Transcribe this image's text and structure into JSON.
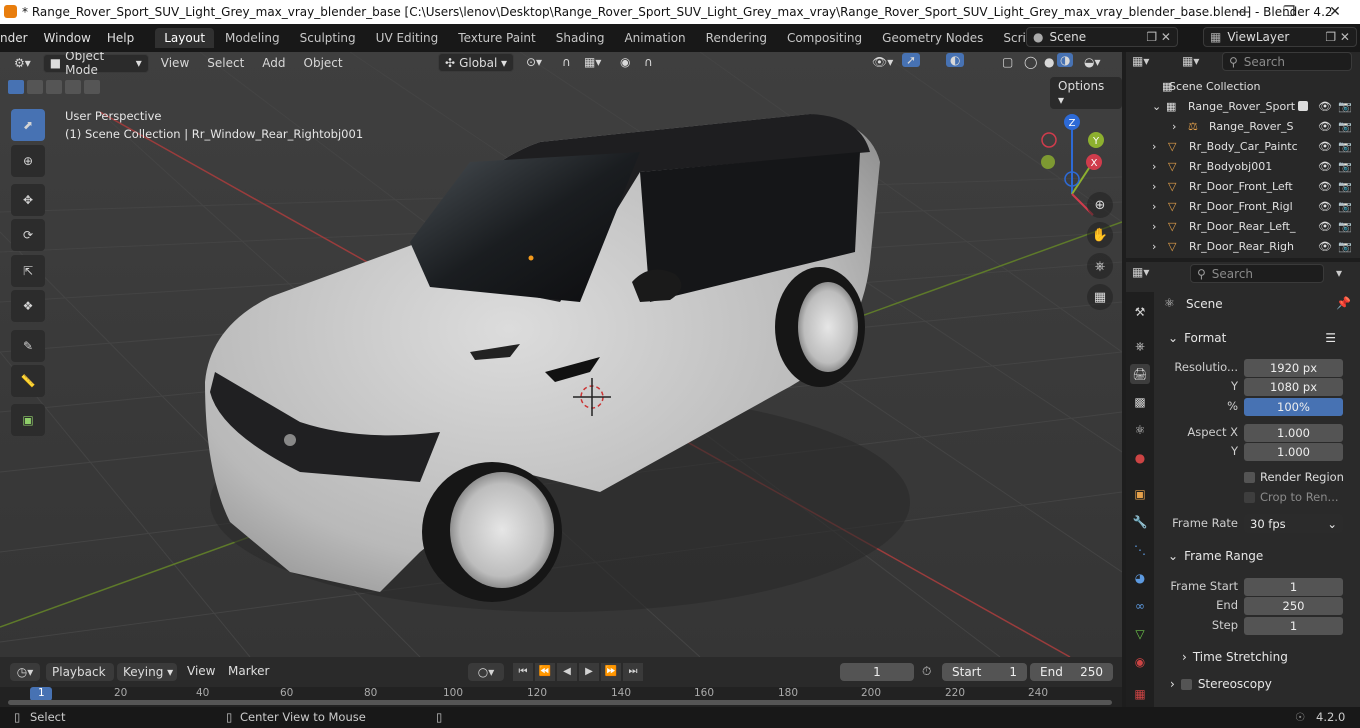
{
  "window": {
    "title": "* Range_Rover_Sport_SUV_Light_Grey_max_vray_blender_base [C:\\Users\\lenov\\Desktop\\Range_Rover_Sport_SUV_Light_Grey_max_vray\\Range_Rover_Sport_SUV_Light_Grey_max_vray_blender_base.blend] - Blender 4.2"
  },
  "menubar": {
    "items": [
      "nder",
      "Window",
      "Help"
    ],
    "workspaces": [
      "Layout",
      "Modeling",
      "Sculpting",
      "UV Editing",
      "Texture Paint",
      "Shading",
      "Animation",
      "Rendering",
      "Compositing",
      "Geometry Nodes",
      "Scripting"
    ],
    "active_workspace": "Layout",
    "add_tab": "+",
    "scene_label": "Scene",
    "viewlayer_label": "ViewLayer"
  },
  "viewport": {
    "mode": "Object Mode",
    "menus": [
      "View",
      "Select",
      "Add",
      "Object"
    ],
    "orientation": "Global",
    "options": "Options",
    "overlay_line1": "User Perspective",
    "overlay_line2": "(1) Scene Collection | Rr_Window_Rear_Rightobj001",
    "gizmo_axes": [
      "X",
      "Y",
      "Z"
    ]
  },
  "outliner": {
    "search_placeholder": "Search",
    "root": "Scene Collection",
    "items": [
      {
        "name": "Range_Rover_Sport",
        "depth": 1
      },
      {
        "name": "Range_Rover_S",
        "depth": 2
      },
      {
        "name": "Rr_Body_Car_Paintc",
        "depth": 1
      },
      {
        "name": "Rr_Bodyobj001",
        "depth": 1
      },
      {
        "name": "Rr_Door_Front_Left",
        "depth": 1
      },
      {
        "name": "Rr_Door_Front_Rigl",
        "depth": 1
      },
      {
        "name": "Rr_Door_Rear_Left_",
        "depth": 1
      },
      {
        "name": "Rr_Door_Rear_Righ",
        "depth": 1
      }
    ]
  },
  "properties": {
    "search_placeholder": "Search",
    "context": "Scene",
    "format": {
      "header": "Format",
      "res_x_label": "Resolutio...",
      "res_x": "1920 px",
      "res_y_label": "Y",
      "res_y": "1080 px",
      "pct_label": "%",
      "pct": "100%",
      "aspect_x_label": "Aspect X",
      "aspect_x": "1.000",
      "aspect_y_label": "Y",
      "aspect_y": "1.000",
      "render_region": "Render Region",
      "crop": "Crop to Ren...",
      "frame_rate_label": "Frame Rate",
      "frame_rate": "30 fps"
    },
    "frame_range": {
      "header": "Frame Range",
      "start_label": "Frame Start",
      "start": "1",
      "end_label": "End",
      "end": "250",
      "step_label": "Step",
      "step": "1"
    },
    "time_stretching": "Time Stretching",
    "stereoscopy": "Stereoscopy"
  },
  "timeline": {
    "menus": [
      "Playback",
      "Keying",
      "View",
      "Marker"
    ],
    "current_frame": "1",
    "start_label": "Start",
    "start": "1",
    "end_label": "End",
    "end": "250",
    "ruler": [
      "1",
      "20",
      "40",
      "60",
      "80",
      "100",
      "120",
      "140",
      "160",
      "180",
      "200",
      "220",
      "240"
    ]
  },
  "statusbar": {
    "select": "Select",
    "center_view": "Center View to Mouse",
    "version": "4.2.0"
  }
}
